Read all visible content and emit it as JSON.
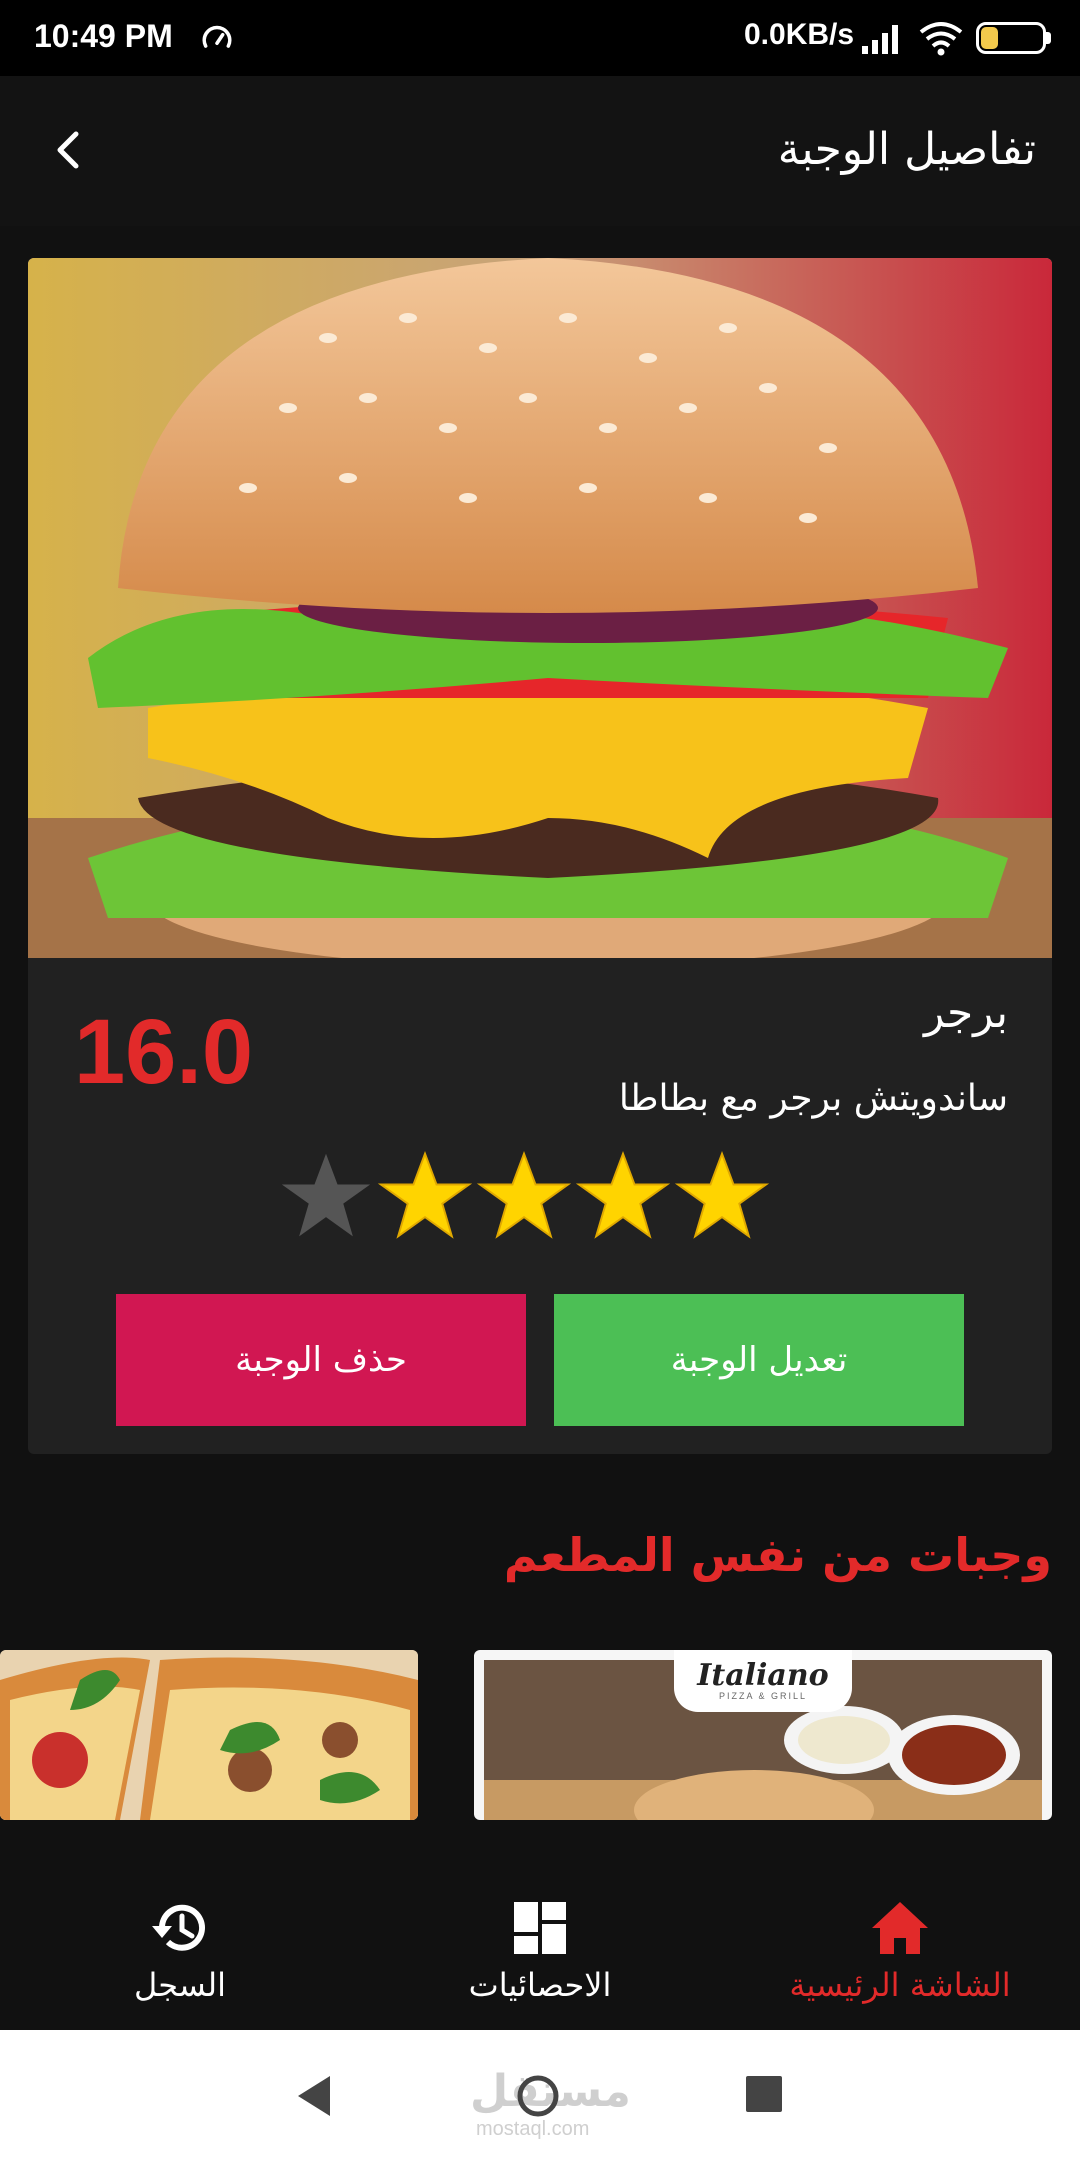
{
  "status_bar": {
    "time": "10:49 PM",
    "network_speed": "0.0KB/s",
    "battery_level": "29",
    "battery_fraction": 0.29,
    "icons": [
      "speedometer-icon",
      "signal-icon",
      "wifi-icon",
      "battery-icon"
    ]
  },
  "app_bar": {
    "title": "تفاصيل الوجبة",
    "back_icon": "chevron-left-icon"
  },
  "meal": {
    "name": "برجر",
    "description": "ساندويتش برجر مع بطاطا",
    "price": "16.0",
    "rating": 4,
    "rating_max": 5,
    "image": "burger-photo"
  },
  "actions": {
    "delete_label": "حذف الوجبة",
    "edit_label": "تعديل الوجبة"
  },
  "same_restaurant": {
    "title": "وجبات من نفس المطعم",
    "items": [
      {
        "image": "sauces-photo",
        "logo_text": "Italiano",
        "logo_sub": "PIZZA & GRILL"
      },
      {
        "image": "pizza-photo"
      }
    ]
  },
  "bottom_nav": {
    "items": [
      {
        "label": "الشاشة الرئيسية",
        "icon": "home-icon",
        "active": true
      },
      {
        "label": "الاحصائيات",
        "icon": "dashboard-icon",
        "active": false
      },
      {
        "label": "السجل",
        "icon": "history-icon",
        "active": false
      }
    ]
  },
  "watermark": {
    "text": "مستقل",
    "sub": "mostaql.com"
  },
  "colors": {
    "accent_red": "#e22a2a",
    "delete_button": "#d11752",
    "edit_button": "#4cbf55",
    "star_active": "#ffd400",
    "star_inactive": "#555555",
    "background": "#111111",
    "card": "#212121"
  }
}
